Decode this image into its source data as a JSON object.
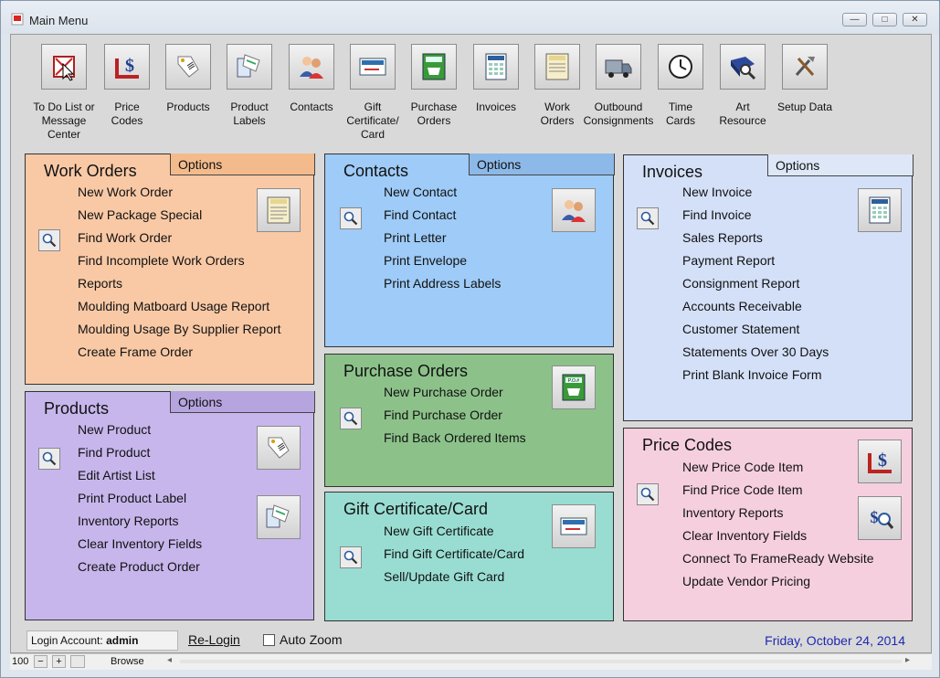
{
  "window": {
    "title": "Main Menu"
  },
  "toolbar": [
    {
      "label": "To Do List or\nMessage\nCenter",
      "icon": "todo-icon"
    },
    {
      "label": "Price\nCodes",
      "icon": "price-codes-icon"
    },
    {
      "label": "Products",
      "icon": "products-icon"
    },
    {
      "label": "Product\nLabels",
      "icon": "product-labels-icon"
    },
    {
      "label": "Contacts",
      "icon": "contacts-icon"
    },
    {
      "label": "Gift\nCertificate/\nCard",
      "icon": "gift-card-icon"
    },
    {
      "label": "Purchase\nOrders",
      "icon": "purchase-orders-icon"
    },
    {
      "label": "Invoices",
      "icon": "invoices-icon"
    },
    {
      "label": "Work\nOrders",
      "icon": "work-orders-icon"
    },
    {
      "label": "Outbound\nConsignments",
      "icon": "truck-icon"
    },
    {
      "label": "Time\nCards",
      "icon": "clock-icon"
    },
    {
      "label": "Art\nResource",
      "icon": "art-resource-icon"
    },
    {
      "label": "Setup Data",
      "icon": "tools-icon"
    }
  ],
  "work_orders": {
    "title": "Work Orders",
    "options": "Options",
    "items": [
      "New Work Order",
      "New Package Special",
      "Find Work Order",
      "Find Incomplete Work Orders",
      "Reports",
      "Moulding Matboard Usage Report",
      "Moulding Usage By Supplier Report",
      "Create Frame Order"
    ]
  },
  "products": {
    "title": "Products",
    "options": "Options",
    "items": [
      "New Product",
      "Find Product",
      "Edit Artist List",
      "Print Product Label",
      "Inventory Reports",
      "Clear Inventory Fields",
      "Create Product Order"
    ]
  },
  "contacts": {
    "title": "Contacts",
    "options": "Options",
    "items": [
      "New Contact",
      "Find Contact",
      "Print Letter",
      "Print Envelope",
      "Print Address Labels"
    ]
  },
  "purchase_orders": {
    "title": "Purchase Orders",
    "items": [
      "New Purchase Order",
      "Find Purchase Order",
      "Find Back Ordered Items"
    ]
  },
  "gift_cert": {
    "title": "Gift Certificate/Card",
    "items": [
      "New Gift Certificate",
      "Find Gift Certificate/Card",
      "Sell/Update Gift Card"
    ]
  },
  "invoices": {
    "title": "Invoices",
    "options": "Options",
    "items": [
      "New Invoice",
      "Find Invoice",
      "Sales Reports",
      "Payment Report",
      "Consignment Report",
      "Accounts Receivable",
      "Customer Statement",
      "Statements Over 30 Days",
      "Print Blank Invoice Form"
    ]
  },
  "price_codes": {
    "title": "Price Codes",
    "items": [
      "New Price Code Item",
      "Find Price Code Item",
      "Inventory Reports",
      "Clear Inventory Fields",
      "Connect To FrameReady Website",
      "Update Vendor Pricing"
    ]
  },
  "footer": {
    "login_label": "Login Account:",
    "login_user": "admin",
    "relogin": "Re-Login",
    "autozoom": "Auto Zoom",
    "date": "Friday, October 24, 2014"
  },
  "statusbar": {
    "zoom": "100",
    "mode": "Browse"
  },
  "colors": {
    "work_orders": "#f9c9a6",
    "products": "#c7b6ec",
    "contacts": "#9ecbf7",
    "purchase_orders": "#8cc28a",
    "gift_cert": "#99ddd2",
    "invoices": "#d3e0f8",
    "price_codes": "#f6cfdf",
    "date_text": "#1f28b0"
  }
}
